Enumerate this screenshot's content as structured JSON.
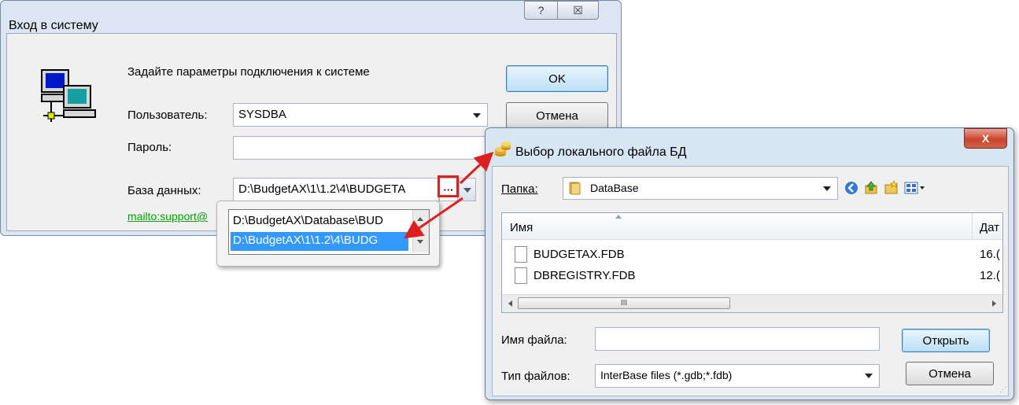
{
  "login": {
    "title": "Вход в систему",
    "help_glyph": "?",
    "close_glyph": "☒",
    "prompt": "Задайте параметры подключения к системе",
    "user_label": "Пользователь:",
    "user_value": "SYSDBA",
    "password_label": "Пароль:",
    "password_value": "",
    "db_label": "База данных:",
    "db_value": "D:\\BudgetAX\\1\\1.2\\4\\BUDGETA",
    "browse_label": "···",
    "ok_label": "OK",
    "cancel_label": "Отмена",
    "mailto": "mailto:support@"
  },
  "db_dropdown": {
    "items": [
      "D:\\BudgetAX\\Database\\BUD",
      "D:\\BudgetAX\\1\\1.2\\4\\BUDG"
    ],
    "selected_index": 1
  },
  "file_dialog": {
    "title": "Выбор локального файла БД",
    "close_glyph": "X",
    "folder_label": "Папка:",
    "folder_value": "DataBase",
    "col_name": "Имя",
    "col_date": "Дат",
    "files": [
      {
        "name": "BUDGETAX.FDB",
        "date": "16.("
      },
      {
        "name": "DBREGISTRY.FDB",
        "date": "12.("
      }
    ],
    "hscroll_grip": "III",
    "filename_label": "Имя файла:",
    "filename_value": "",
    "filetype_label": "Тип файлов:",
    "filetype_value": "InterBase files (*.gdb;*.fdb)",
    "open_label": "Открыть",
    "cancel_label": "Отмена"
  },
  "colors": {
    "accent_red": "#e01e1e",
    "selection": "#3399ff",
    "link_green": "#00a000"
  },
  "icons": [
    "computer-network-icon",
    "database-icon",
    "folder-icon",
    "back-icon",
    "up-folder-icon",
    "new-folder-icon",
    "view-menu-icon",
    "file-icon"
  ]
}
